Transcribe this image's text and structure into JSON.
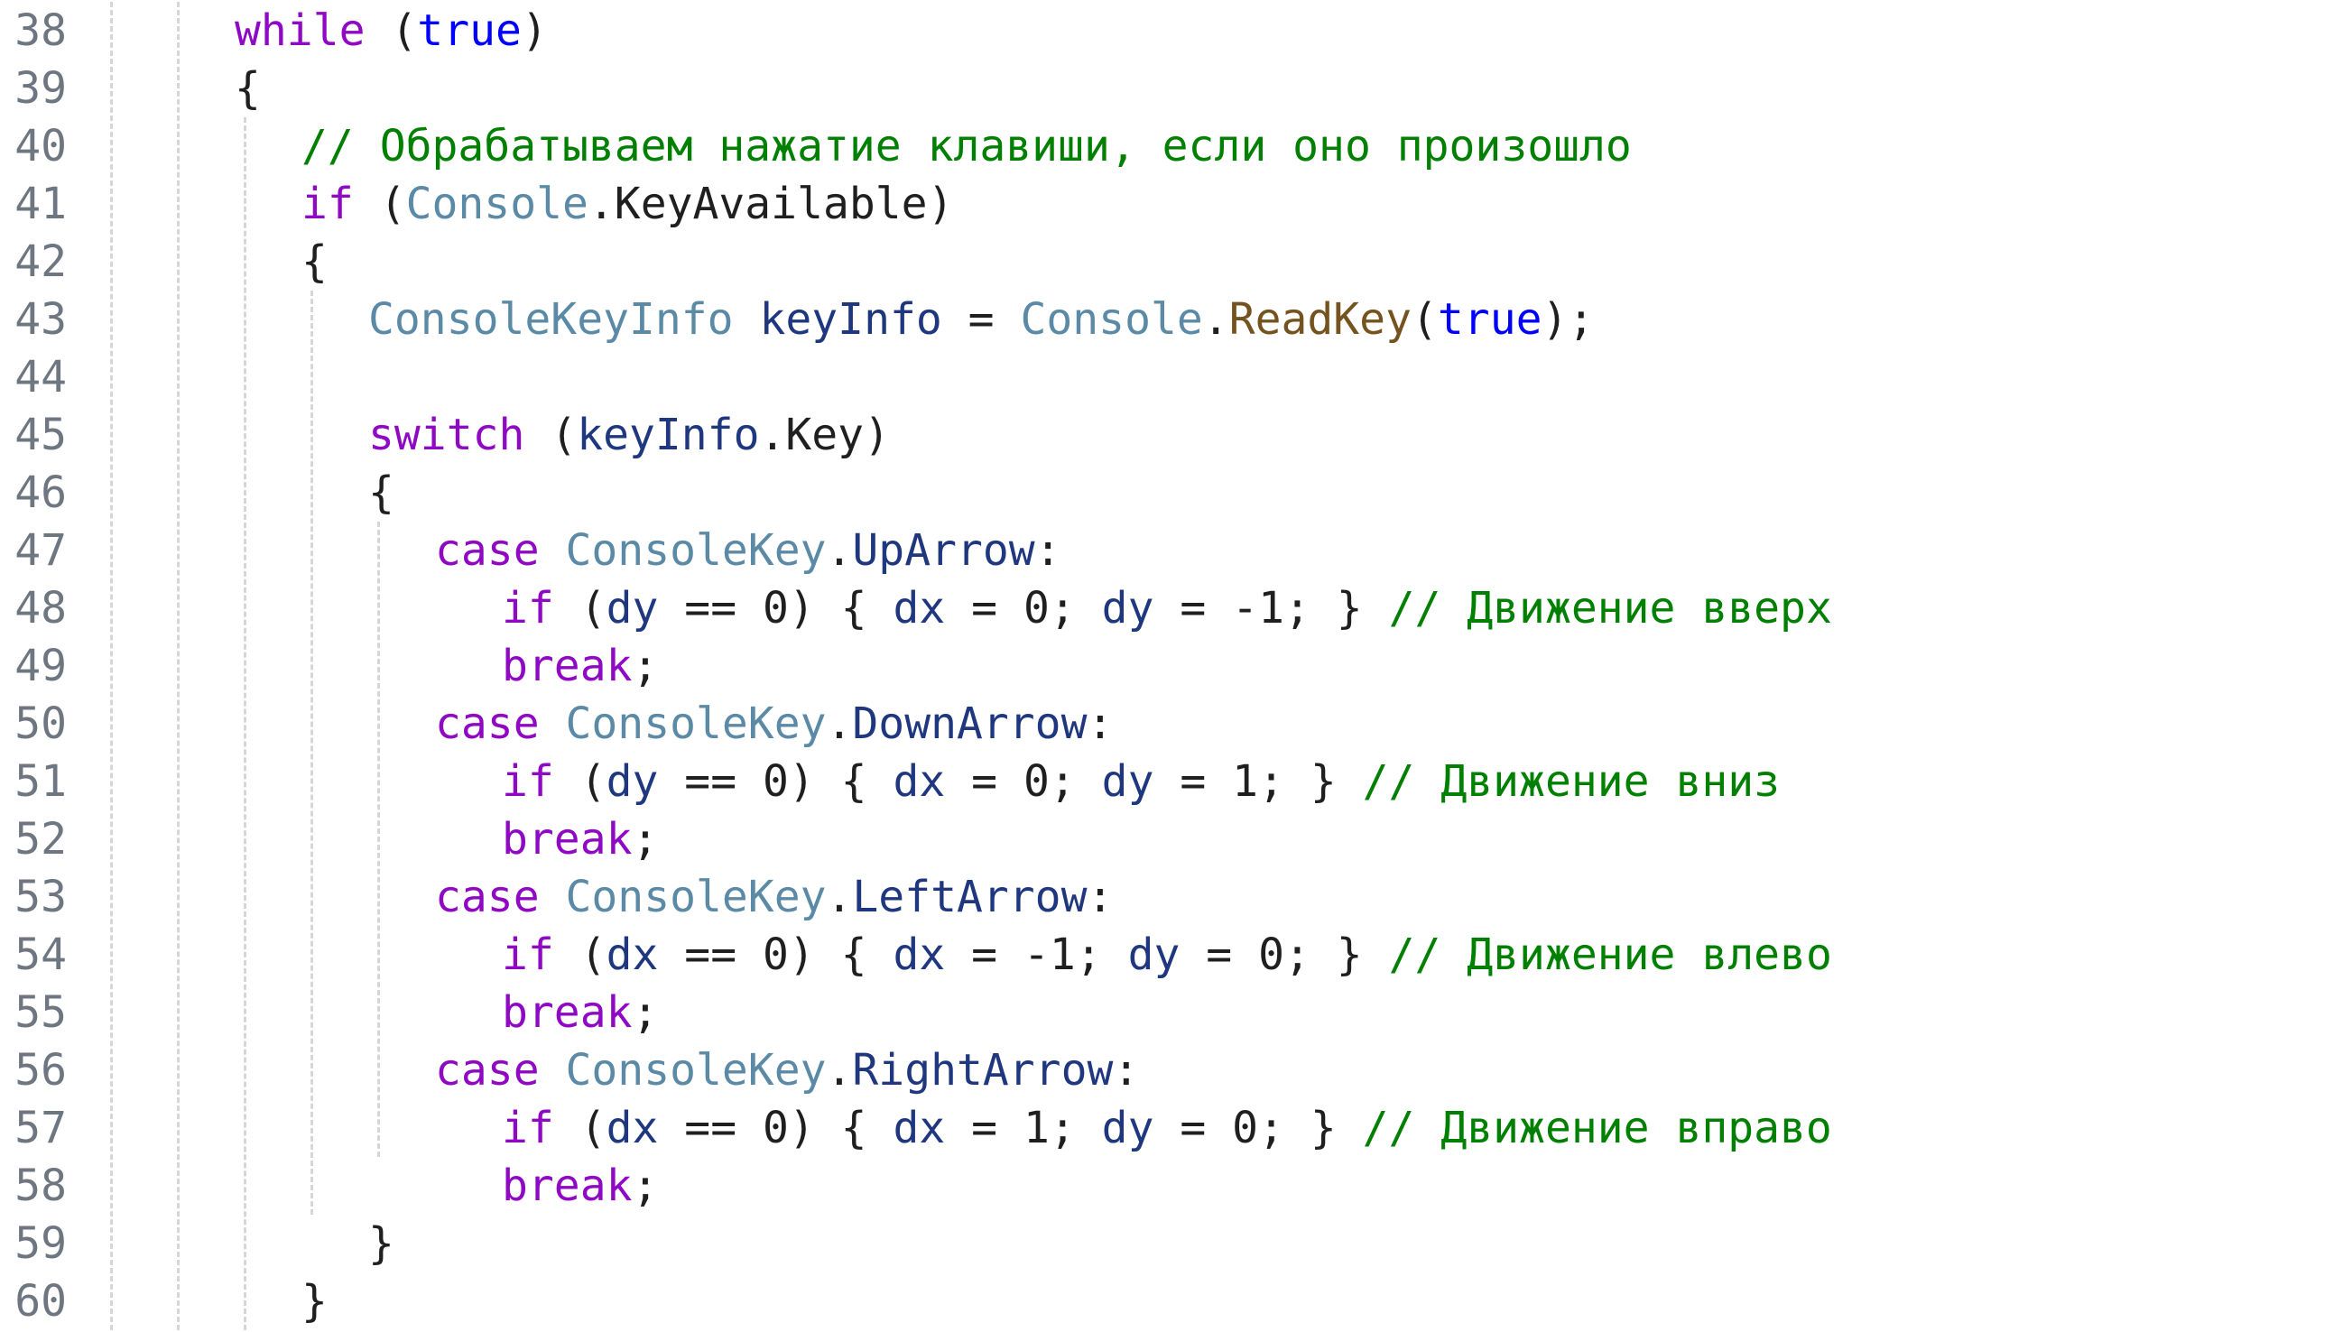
{
  "editor": {
    "lines": [
      {
        "num": "38",
        "indent": 0,
        "tokens": [
          {
            "t": "while",
            "c": "kw"
          },
          {
            "t": " (",
            "c": "punc"
          },
          {
            "t": "true",
            "c": "lit"
          },
          {
            "t": ")",
            "c": "punc"
          }
        ]
      },
      {
        "num": "39",
        "indent": 0,
        "tokens": [
          {
            "t": "{",
            "c": "punc"
          }
        ]
      },
      {
        "num": "40",
        "indent": 1,
        "tokens": [
          {
            "t": "// Обрабатываем нажатие клавиши, если оно произошло",
            "c": "cmt"
          }
        ]
      },
      {
        "num": "41",
        "indent": 1,
        "tokens": [
          {
            "t": "if",
            "c": "kw"
          },
          {
            "t": " (",
            "c": "punc"
          },
          {
            "t": "Console",
            "c": "typ2"
          },
          {
            "t": ".KeyAvailable)",
            "c": "punc"
          }
        ]
      },
      {
        "num": "42",
        "indent": 1,
        "tokens": [
          {
            "t": "{",
            "c": "punc"
          }
        ]
      },
      {
        "num": "43",
        "indent": 2,
        "tokens": [
          {
            "t": "ConsoleKeyInfo",
            "c": "typ2"
          },
          {
            "t": " ",
            "c": "punc"
          },
          {
            "t": "keyInfo",
            "c": "ident"
          },
          {
            "t": " = ",
            "c": "punc"
          },
          {
            "t": "Console",
            "c": "typ2"
          },
          {
            "t": ".",
            "c": "punc"
          },
          {
            "t": "ReadKey",
            "c": "method"
          },
          {
            "t": "(",
            "c": "punc"
          },
          {
            "t": "true",
            "c": "lit"
          },
          {
            "t": ");",
            "c": "punc"
          }
        ]
      },
      {
        "num": "44",
        "indent": 2,
        "tokens": []
      },
      {
        "num": "45",
        "indent": 2,
        "tokens": [
          {
            "t": "switch",
            "c": "kw"
          },
          {
            "t": " (",
            "c": "punc"
          },
          {
            "t": "keyInfo",
            "c": "ident"
          },
          {
            "t": ".Key)",
            "c": "punc"
          }
        ]
      },
      {
        "num": "46",
        "indent": 2,
        "tokens": [
          {
            "t": "{",
            "c": "punc"
          }
        ]
      },
      {
        "num": "47",
        "indent": 3,
        "tokens": [
          {
            "t": "case",
            "c": "kw"
          },
          {
            "t": " ",
            "c": "punc"
          },
          {
            "t": "ConsoleKey",
            "c": "typ2"
          },
          {
            "t": ".",
            "c": "punc"
          },
          {
            "t": "UpArrow",
            "c": "member"
          },
          {
            "t": ":",
            "c": "punc"
          }
        ]
      },
      {
        "num": "48",
        "indent": 4,
        "tokens": [
          {
            "t": "if",
            "c": "kw"
          },
          {
            "t": " (",
            "c": "punc"
          },
          {
            "t": "dy",
            "c": "ident"
          },
          {
            "t": " == 0) { ",
            "c": "punc"
          },
          {
            "t": "dx",
            "c": "ident"
          },
          {
            "t": " = 0; ",
            "c": "punc"
          },
          {
            "t": "dy",
            "c": "ident"
          },
          {
            "t": " = -1; } ",
            "c": "punc"
          },
          {
            "t": "// Движение вверх",
            "c": "cmt"
          }
        ]
      },
      {
        "num": "49",
        "indent": 4,
        "tokens": [
          {
            "t": "break",
            "c": "kw"
          },
          {
            "t": ";",
            "c": "punc"
          }
        ]
      },
      {
        "num": "50",
        "indent": 3,
        "tokens": [
          {
            "t": "case",
            "c": "kw"
          },
          {
            "t": " ",
            "c": "punc"
          },
          {
            "t": "ConsoleKey",
            "c": "typ2"
          },
          {
            "t": ".",
            "c": "punc"
          },
          {
            "t": "DownArrow",
            "c": "member"
          },
          {
            "t": ":",
            "c": "punc"
          }
        ]
      },
      {
        "num": "51",
        "indent": 4,
        "tokens": [
          {
            "t": "if",
            "c": "kw"
          },
          {
            "t": " (",
            "c": "punc"
          },
          {
            "t": "dy",
            "c": "ident"
          },
          {
            "t": " == 0) { ",
            "c": "punc"
          },
          {
            "t": "dx",
            "c": "ident"
          },
          {
            "t": " = 0; ",
            "c": "punc"
          },
          {
            "t": "dy",
            "c": "ident"
          },
          {
            "t": " = 1; } ",
            "c": "punc"
          },
          {
            "t": "// Движение вниз",
            "c": "cmt"
          }
        ]
      },
      {
        "num": "52",
        "indent": 4,
        "tokens": [
          {
            "t": "break",
            "c": "kw"
          },
          {
            "t": ";",
            "c": "punc"
          }
        ]
      },
      {
        "num": "53",
        "indent": 3,
        "tokens": [
          {
            "t": "case",
            "c": "kw"
          },
          {
            "t": " ",
            "c": "punc"
          },
          {
            "t": "ConsoleKey",
            "c": "typ2"
          },
          {
            "t": ".",
            "c": "punc"
          },
          {
            "t": "LeftArrow",
            "c": "member"
          },
          {
            "t": ":",
            "c": "punc"
          }
        ]
      },
      {
        "num": "54",
        "indent": 4,
        "tokens": [
          {
            "t": "if",
            "c": "kw"
          },
          {
            "t": " (",
            "c": "punc"
          },
          {
            "t": "dx",
            "c": "ident"
          },
          {
            "t": " == 0) { ",
            "c": "punc"
          },
          {
            "t": "dx",
            "c": "ident"
          },
          {
            "t": " = -1; ",
            "c": "punc"
          },
          {
            "t": "dy",
            "c": "ident"
          },
          {
            "t": " = 0; } ",
            "c": "punc"
          },
          {
            "t": "// Движение влево",
            "c": "cmt"
          }
        ]
      },
      {
        "num": "55",
        "indent": 4,
        "tokens": [
          {
            "t": "break",
            "c": "kw"
          },
          {
            "t": ";",
            "c": "punc"
          }
        ]
      },
      {
        "num": "56",
        "indent": 3,
        "tokens": [
          {
            "t": "case",
            "c": "kw"
          },
          {
            "t": " ",
            "c": "punc"
          },
          {
            "t": "ConsoleKey",
            "c": "typ2"
          },
          {
            "t": ".",
            "c": "punc"
          },
          {
            "t": "RightArrow",
            "c": "member"
          },
          {
            "t": ":",
            "c": "punc"
          }
        ]
      },
      {
        "num": "57",
        "indent": 4,
        "tokens": [
          {
            "t": "if",
            "c": "kw"
          },
          {
            "t": " (",
            "c": "punc"
          },
          {
            "t": "dx",
            "c": "ident"
          },
          {
            "t": " == 0) { ",
            "c": "punc"
          },
          {
            "t": "dx",
            "c": "ident"
          },
          {
            "t": " = 1; ",
            "c": "punc"
          },
          {
            "t": "dy",
            "c": "ident"
          },
          {
            "t": " = 0; } ",
            "c": "punc"
          },
          {
            "t": "// Движение вправо",
            "c": "cmt"
          }
        ]
      },
      {
        "num": "58",
        "indent": 4,
        "tokens": [
          {
            "t": "break",
            "c": "kw"
          },
          {
            "t": ";",
            "c": "punc"
          }
        ]
      },
      {
        "num": "59",
        "indent": 2,
        "tokens": [
          {
            "t": "}",
            "c": "punc"
          }
        ]
      },
      {
        "num": "60",
        "indent": 1,
        "tokens": [
          {
            "t": "}",
            "c": "punc"
          }
        ]
      }
    ]
  },
  "colors": {
    "keyword": "#8f08c4",
    "literal": "#0000ff",
    "type": "#5b8aa6",
    "identifier": "#1f377f",
    "method": "#74531f",
    "comment": "#008000",
    "text": "#1f1f1f",
    "line_number": "#6e7681",
    "guide": "#d6d6d6"
  }
}
